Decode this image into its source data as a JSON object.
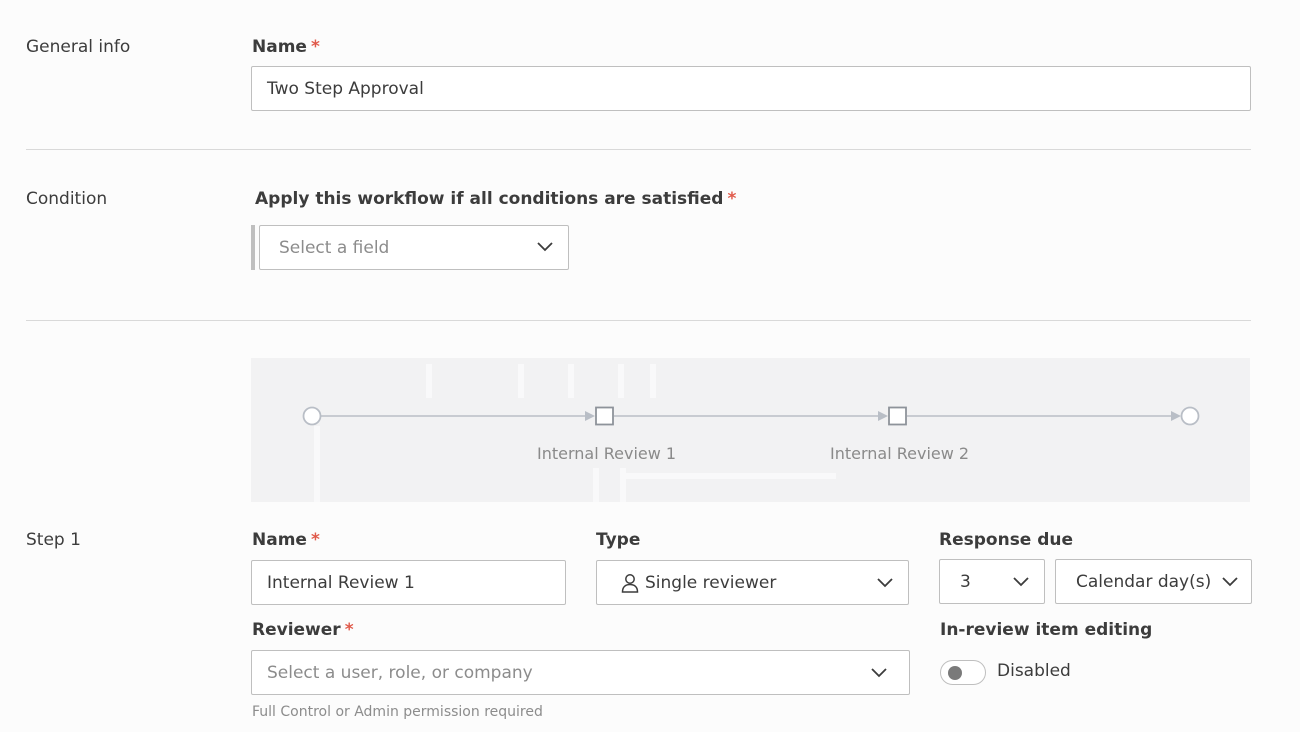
{
  "general": {
    "section_label": "General info",
    "name_label": "Name",
    "name_value": "Two Step Approval"
  },
  "condition": {
    "section_label": "Condition",
    "rule_label": "Apply this workflow if all conditions are satisfied",
    "field_placeholder": "Select a field"
  },
  "diagram": {
    "steps": [
      "Internal Review 1",
      "Internal Review 2"
    ]
  },
  "step1": {
    "section_label": "Step 1",
    "name_label": "Name",
    "name_value": "Internal Review 1",
    "type_label": "Type",
    "type_icon": "person-icon",
    "type_value": "Single reviewer",
    "response_due_label": "Response due",
    "response_due_count": "3",
    "response_due_unit": "Calendar day(s)",
    "reviewer_label": "Reviewer",
    "reviewer_placeholder": "Select a user, role, or company",
    "reviewer_helper": "Full Control or Admin permission required",
    "editing_label": "In-review item editing",
    "editing_toggle_label": "Disabled",
    "editing_enabled": false
  },
  "colors": {
    "required_marker": "#e05a4b",
    "diagram_bg": "#f2f2f3",
    "divider": "#d9d9d9"
  }
}
